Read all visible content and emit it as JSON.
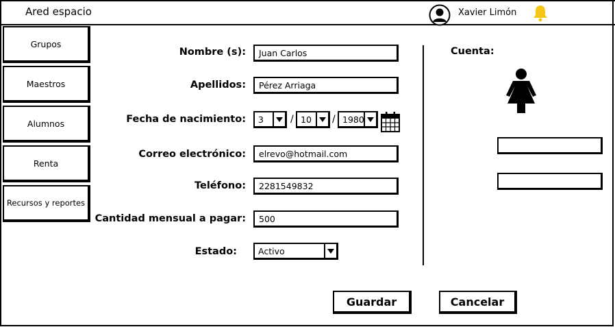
{
  "header": {
    "app_title": "Ared espacio",
    "user_name": "Xavier Limón",
    "user_icon": "user-avatar-icon",
    "notification_icon": "bell-icon",
    "bell_color": "#f5c518"
  },
  "sidebar": {
    "items": [
      {
        "label": "Grupos"
      },
      {
        "label": "Maestros"
      },
      {
        "label": "Alumnos"
      },
      {
        "label": "Renta"
      },
      {
        "label": "Recursos y reportes"
      }
    ]
  },
  "form": {
    "nombre": {
      "label": "Nombre (s):",
      "value": "Juan Carlos"
    },
    "apellidos": {
      "label": "Apellidos:",
      "value": "Pérez Arriaga"
    },
    "fecha": {
      "label": "Fecha de nacimiento:",
      "day": "3",
      "month": "10",
      "year": "1980",
      "separator": "/",
      "calendar_icon": "calendar-icon"
    },
    "correo": {
      "label": "Correo electrónico:",
      "value": "elrevo@hotmail.com"
    },
    "telefono": {
      "label": "Teléfono:",
      "value": "2281549832"
    },
    "cantidad": {
      "label": "Cantidad mensual a pagar:",
      "value": "500"
    },
    "estado": {
      "label": "Estado:",
      "value": "Activo"
    }
  },
  "account": {
    "label": "Cuenta:",
    "person_icon": "person-icon",
    "field1": "",
    "field2": ""
  },
  "actions": {
    "save_label": "Guardar",
    "cancel_label": "Cancelar"
  }
}
